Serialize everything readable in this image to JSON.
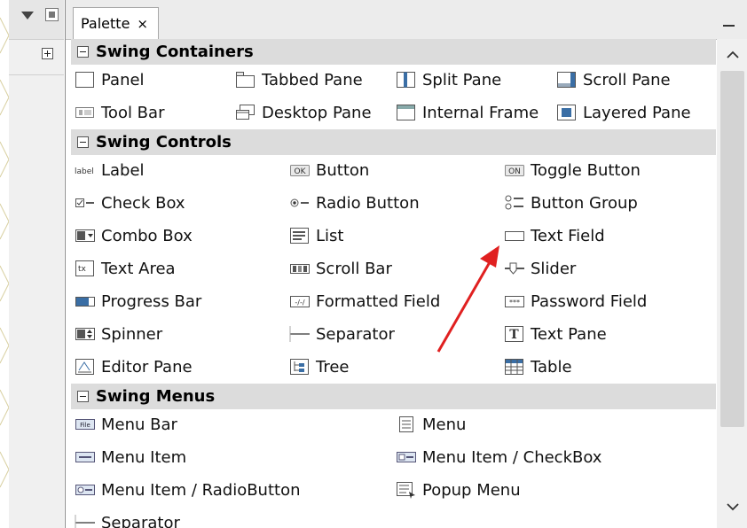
{
  "palette_tab": {
    "title": "Palette",
    "close_glyph": "×"
  },
  "categories": [
    {
      "name": "Swing Containers",
      "items": [
        {
          "label": "Panel",
          "icon": "panel-icon"
        },
        {
          "label": "Tabbed Pane",
          "icon": "tabbed-pane-icon"
        },
        {
          "label": "Split Pane",
          "icon": "split-pane-icon"
        },
        {
          "label": "Scroll Pane",
          "icon": "scroll-pane-icon"
        },
        {
          "label": "Tool Bar",
          "icon": "tool-bar-icon"
        },
        {
          "label": "Desktop Pane",
          "icon": "desktop-pane-icon"
        },
        {
          "label": "Internal Frame",
          "icon": "internal-frame-icon"
        },
        {
          "label": "Layered Pane",
          "icon": "layered-pane-icon"
        }
      ]
    },
    {
      "name": "Swing Controls",
      "items": [
        {
          "label": "Label",
          "icon": "label-icon",
          "icon_text": "label"
        },
        {
          "label": "Button",
          "icon": "button-icon",
          "icon_text": "OK"
        },
        {
          "label": "Toggle Button",
          "icon": "toggle-button-icon",
          "icon_text": "ON"
        },
        {
          "label": "Check Box",
          "icon": "check-box-icon"
        },
        {
          "label": "Radio Button",
          "icon": "radio-button-icon"
        },
        {
          "label": "Button Group",
          "icon": "button-group-icon"
        },
        {
          "label": "Combo Box",
          "icon": "combo-box-icon"
        },
        {
          "label": "List",
          "icon": "list-icon"
        },
        {
          "label": "Text Field",
          "icon": "text-field-icon"
        },
        {
          "label": "Text Area",
          "icon": "text-area-icon",
          "icon_text": "tx"
        },
        {
          "label": "Scroll Bar",
          "icon": "scroll-bar-icon"
        },
        {
          "label": "Slider",
          "icon": "slider-icon"
        },
        {
          "label": "Progress Bar",
          "icon": "progress-bar-icon"
        },
        {
          "label": "Formatted Field",
          "icon": "formatted-field-icon",
          "icon_text": "-/-/"
        },
        {
          "label": "Password Field",
          "icon": "password-field-icon",
          "icon_text": "***"
        },
        {
          "label": "Spinner",
          "icon": "spinner-icon"
        },
        {
          "label": "Separator",
          "icon": "separator-icon"
        },
        {
          "label": "Text Pane",
          "icon": "text-pane-icon",
          "icon_text": "T"
        },
        {
          "label": "Editor Pane",
          "icon": "editor-pane-icon"
        },
        {
          "label": "Tree",
          "icon": "tree-icon"
        },
        {
          "label": "Table",
          "icon": "table-icon"
        }
      ]
    },
    {
      "name": "Swing Menus",
      "items": [
        {
          "label": "Menu Bar",
          "icon": "menu-bar-icon",
          "icon_text": "File"
        },
        {
          "label": "Menu",
          "icon": "menu-icon"
        },
        {
          "label": "Menu Item",
          "icon": "menu-item-icon"
        },
        {
          "label": "Menu Item / CheckBox",
          "icon": "menu-item-checkbox-icon"
        },
        {
          "label": "Menu Item / RadioButton",
          "icon": "menu-item-radiobutton-icon"
        },
        {
          "label": "Popup Menu",
          "icon": "popup-menu-icon"
        },
        {
          "label": "Separator",
          "icon": "menu-separator-icon"
        }
      ]
    }
  ],
  "colors": {
    "category_header_bg": "#dcdcdc",
    "annotation_arrow": "#e02020",
    "icon_blue": "#3a6ea5"
  }
}
